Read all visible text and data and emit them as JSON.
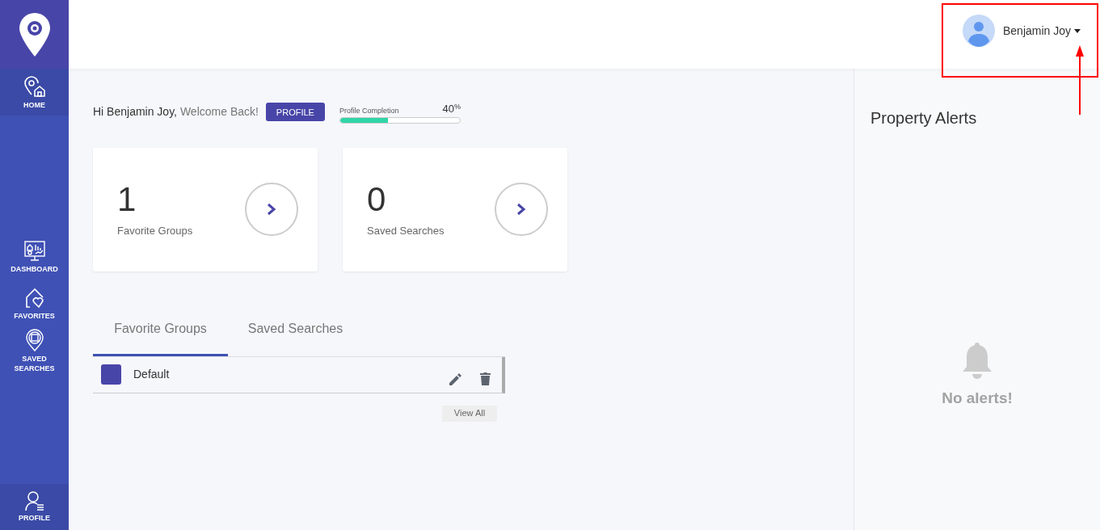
{
  "sidebar": {
    "items": [
      {
        "label": "HOME",
        "selected": true
      },
      {
        "label": "DASHBOARD",
        "selected": false
      },
      {
        "label": "FAVORITES",
        "selected": false
      },
      {
        "label": "SAVED SEARCHES",
        "selected": false
      }
    ],
    "footer_item": {
      "label": "PROFILE"
    }
  },
  "header": {
    "user_name": "Benjamin Joy"
  },
  "welcome": {
    "greeting": "Hi Benjamin Joy,",
    "message": "Welcome Back!",
    "profile_button": "PROFILE",
    "completion_label": "Profile Completion",
    "completion_value": "40",
    "completion_unit": "%",
    "level": 0.4
  },
  "stat_cards": [
    {
      "count": "1",
      "label": "Favorite Groups"
    },
    {
      "count": "0",
      "label": "Saved Searches"
    }
  ],
  "tabs": [
    {
      "label": "Favorite Groups",
      "selected": true
    },
    {
      "label": "Saved Searches",
      "selected": false
    }
  ],
  "groups": [
    {
      "name": "Default",
      "color": "#4845a8"
    }
  ],
  "view_all": "View All",
  "alerts": {
    "title": "Property Alerts",
    "empty_message": "No alerts!"
  }
}
